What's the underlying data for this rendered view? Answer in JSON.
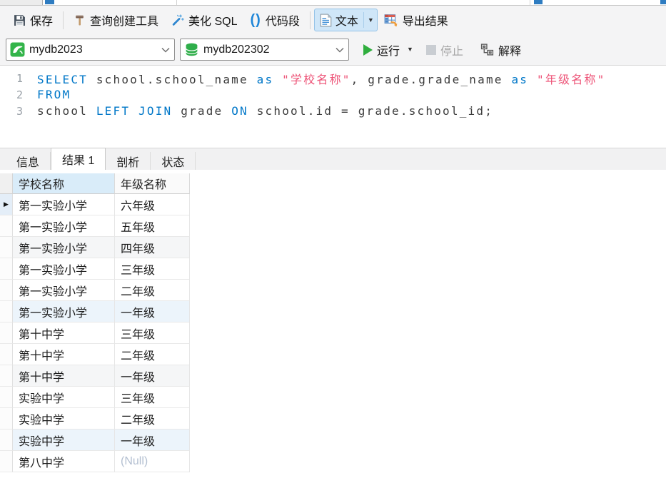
{
  "toolbar": {
    "save": "保存",
    "query_builder": "查询创建工具",
    "beautify_sql": "美化 SQL",
    "code_snippet": "代码段",
    "text_view": "文本",
    "export_result": "导出结果"
  },
  "connection_bar": {
    "connection": "mydb2023",
    "database": "mydb202302",
    "run": "运行",
    "stop": "停止",
    "explain": "解释"
  },
  "editor": {
    "lines": [
      {
        "no": "1",
        "tokens": [
          [
            "kw",
            "SELECT"
          ],
          [
            "pl",
            " school.school_name "
          ],
          [
            "kw",
            "as"
          ],
          [
            "pl",
            " "
          ],
          [
            "str",
            "\"学校名称\""
          ],
          [
            "pl",
            ", grade.grade_name "
          ],
          [
            "kw",
            "as"
          ],
          [
            "pl",
            " "
          ],
          [
            "str",
            "\"年级名称\""
          ]
        ]
      },
      {
        "no": "2",
        "tokens": [
          [
            "kw",
            "FROM"
          ]
        ]
      },
      {
        "no": "3",
        "tokens": [
          [
            "pl",
            "school "
          ],
          [
            "kw",
            "LEFT"
          ],
          [
            "pl",
            " "
          ],
          [
            "kw",
            "JOIN"
          ],
          [
            "pl",
            " grade "
          ],
          [
            "kw",
            "ON"
          ],
          [
            "pl",
            " school.id = grade.school_id;"
          ]
        ]
      }
    ]
  },
  "result_tabs": {
    "tabs": [
      {
        "label": "信息",
        "active": false
      },
      {
        "label": "结果 1",
        "active": true
      },
      {
        "label": "剖析",
        "active": false
      },
      {
        "label": "状态",
        "active": false
      }
    ]
  },
  "grid": {
    "columns": [
      "学校名称",
      "年级名称"
    ],
    "null_text": "(Null)",
    "rows": [
      {
        "school": "第一实验小学",
        "grade": "六年级",
        "tint": "",
        "current": true
      },
      {
        "school": "第一实验小学",
        "grade": "五年级",
        "tint": ""
      },
      {
        "school": "第一实验小学",
        "grade": "四年级",
        "tint": "gray"
      },
      {
        "school": "第一实验小学",
        "grade": "三年级",
        "tint": ""
      },
      {
        "school": "第一实验小学",
        "grade": "二年级",
        "tint": ""
      },
      {
        "school": "第一实验小学",
        "grade": "一年级",
        "tint": "blue"
      },
      {
        "school": "第十中学",
        "grade": "三年级",
        "tint": ""
      },
      {
        "school": "第十中学",
        "grade": "二年级",
        "tint": ""
      },
      {
        "school": "第十中学",
        "grade": "一年级",
        "tint": "gray"
      },
      {
        "school": "实验中学",
        "grade": "三年级",
        "tint": ""
      },
      {
        "school": "实验中学",
        "grade": "二年级",
        "tint": ""
      },
      {
        "school": "实验中学",
        "grade": "一年级",
        "tint": "blue"
      },
      {
        "school": "第八中学",
        "grade": null,
        "tint": ""
      }
    ]
  },
  "colors": {
    "keyword": "#0077C8",
    "string": "#ED5377",
    "accent_blue": "#2E7CC1",
    "run_green": "#2FAE3E",
    "selected_header_bg": "#D9ECF9"
  }
}
